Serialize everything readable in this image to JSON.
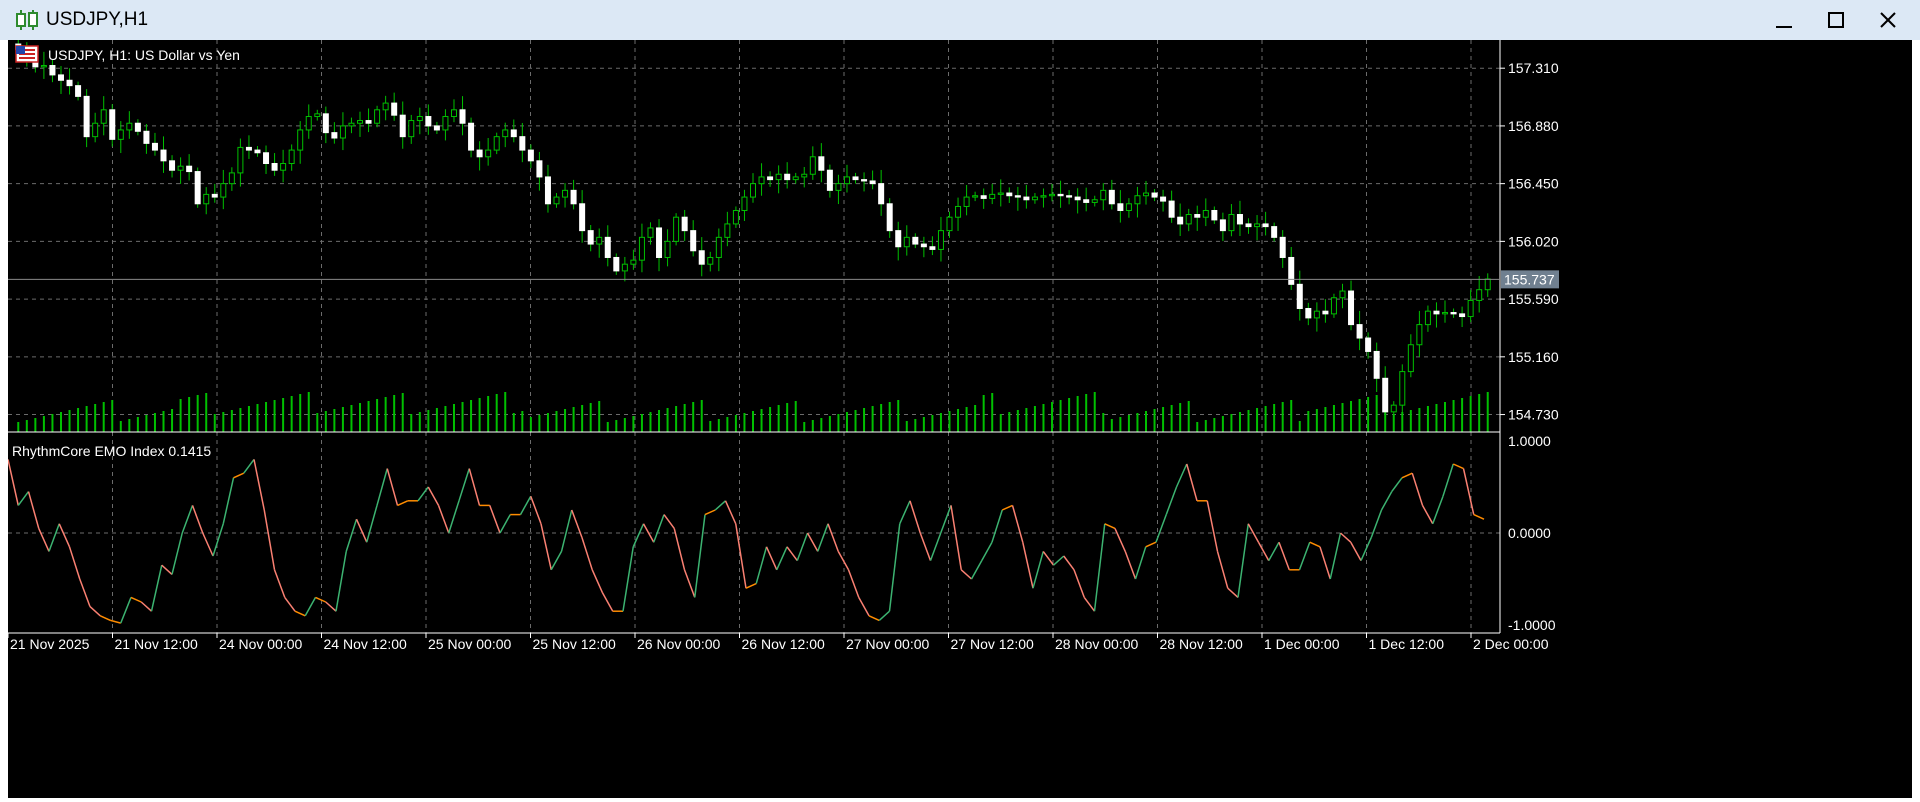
{
  "window": {
    "title": "USDJPY,H1",
    "icon": "candlestick-icon",
    "controls": [
      "minimize-icon",
      "maximize-icon",
      "close-icon"
    ]
  },
  "chart": {
    "symbol_label": "USDJPY, H1:  US Dollar vs Yen",
    "flag_icon": "symbol-flag-icon",
    "current_price": "155.737",
    "price_axis": [
      "157.310",
      "156.880",
      "156.450",
      "156.020",
      "155.590",
      "155.160",
      "154.730"
    ],
    "time_axis": [
      "21 Nov 2025",
      "21 Nov 12:00",
      "24 Nov 00:00",
      "24 Nov 12:00",
      "25 Nov 00:00",
      "25 Nov 12:00",
      "26 Nov 00:00",
      "26 Nov 12:00",
      "27 Nov 00:00",
      "27 Nov 12:00",
      "28 Nov 00:00",
      "28 Nov 12:00",
      "1 Dec 00:00",
      "1 Dec 12:00",
      "2 Dec 00:00"
    ],
    "indicator_label": "RhythmCore EMO Index 0.1415",
    "indicator_axis": [
      "1.0000",
      "0.0000",
      "-1.0000"
    ],
    "colors": {
      "background": "#000000",
      "grid": "#6b6b6b",
      "bull_candle": "#00c000",
      "bear_candle": "#ffffff",
      "volume": "#00c000",
      "indicator_up": "#3cb371",
      "indicator_down": "#fa8072",
      "indicator_neutral": "#ff8c00",
      "axis_text": "#ffffff",
      "price_tag_bg": "#708090"
    }
  },
  "chart_data": [
    {
      "type": "candlestick",
      "title": "USDJPY, H1:  US Dollar vs Yen",
      "timeframe": "H1",
      "y_ticks": [
        157.31,
        156.88,
        156.45,
        156.02,
        155.59,
        155.16,
        154.73
      ],
      "ylim": [
        154.6,
        157.52
      ],
      "x_ticks": [
        "21 Nov 2025",
        "21 Nov 12:00",
        "24 Nov 00:00",
        "24 Nov 12:00",
        "25 Nov 00:00",
        "25 Nov 12:00",
        "26 Nov 00:00",
        "26 Nov 12:00",
        "27 Nov 00:00",
        "27 Nov 12:00",
        "28 Nov 00:00",
        "28 Nov 12:00",
        "1 Dec 00:00",
        "1 Dec 12:00",
        "2 Dec 00:00"
      ],
      "last_price": 155.737,
      "close": [
        157.45,
        157.4,
        157.32,
        157.33,
        157.26,
        157.22,
        157.18,
        157.1,
        156.8,
        156.9,
        157.0,
        156.78,
        156.85,
        156.9,
        156.84,
        156.75,
        156.7,
        156.62,
        156.55,
        156.58,
        156.54,
        156.3,
        156.37,
        156.35,
        156.45,
        156.53,
        156.72,
        156.7,
        156.68,
        156.6,
        156.55,
        156.6,
        156.7,
        156.85,
        156.95,
        156.97,
        156.83,
        156.79,
        156.88,
        156.9,
        156.92,
        156.9,
        157.0,
        157.05,
        156.96,
        156.8,
        156.92,
        156.95,
        156.88,
        156.85,
        156.95,
        157.0,
        156.9,
        156.7,
        156.65,
        156.7,
        156.8,
        156.85,
        156.8,
        156.7,
        156.62,
        156.5,
        156.3,
        156.35,
        156.4,
        156.3,
        156.1,
        156.0,
        156.05,
        155.9,
        155.8,
        155.85,
        155.88,
        156.05,
        156.12,
        155.9,
        156.02,
        156.2,
        156.1,
        155.95,
        155.85,
        155.9,
        156.05,
        156.15,
        156.25,
        156.35,
        156.45,
        156.5,
        156.48,
        156.52,
        156.48,
        156.5,
        156.52,
        156.65,
        156.55,
        156.4,
        156.45,
        156.5,
        156.48,
        156.47,
        156.45,
        156.3,
        156.1,
        155.98,
        156.05,
        156.0,
        155.98,
        155.96,
        156.1,
        156.2,
        156.28,
        156.35,
        156.36,
        156.34,
        156.37,
        156.38,
        156.36,
        156.35,
        156.33,
        156.35,
        156.36,
        156.37,
        156.36,
        156.35,
        156.33,
        156.31,
        156.33,
        156.4,
        156.3,
        156.25,
        156.3,
        156.36,
        156.38,
        156.35,
        156.32,
        156.2,
        156.15,
        156.22,
        156.2,
        156.25,
        156.18,
        156.1,
        156.22,
        156.15,
        156.13,
        156.15,
        156.13,
        156.05,
        155.9,
        155.7,
        155.52,
        155.45,
        155.5,
        155.48,
        155.6,
        155.65,
        155.4,
        155.3,
        155.2,
        155.0,
        154.75,
        154.8,
        155.05,
        155.25,
        155.4,
        155.5,
        155.48,
        155.49,
        155.48,
        155.46,
        155.58,
        155.66,
        155.74
      ],
      "volume_unit": "relative",
      "volume_pattern": "tick volume histogram, higher during 21 Nov 12:00-25 Nov 12:00, 28 Nov 00:00-12:00 and 1 Dec"
    },
    {
      "type": "line",
      "title": "RhythmCore EMO Index 0.1415",
      "ylim": [
        -1.0,
        1.0
      ],
      "y_ticks": [
        1.0,
        0.0,
        -1.0
      ],
      "values": [
        0.8,
        0.3,
        0.45,
        0.05,
        -0.2,
        0.1,
        -0.15,
        -0.5,
        -0.8,
        -0.9,
        -0.95,
        -0.98,
        -0.7,
        -0.75,
        -0.85,
        -0.35,
        -0.45,
        0.0,
        0.3,
        0.0,
        -0.25,
        0.1,
        0.6,
        0.65,
        0.8,
        0.25,
        -0.4,
        -0.7,
        -0.85,
        -0.9,
        -0.7,
        -0.75,
        -0.85,
        -0.2,
        0.15,
        -0.1,
        0.3,
        0.7,
        0.3,
        0.35,
        0.35,
        0.5,
        0.3,
        0.0,
        0.35,
        0.7,
        0.3,
        0.3,
        0.0,
        0.2,
        0.2,
        0.4,
        0.1,
        -0.4,
        -0.2,
        0.25,
        -0.05,
        -0.4,
        -0.65,
        -0.85,
        -0.85,
        -0.15,
        0.1,
        -0.1,
        0.2,
        0.05,
        -0.4,
        -0.7,
        0.2,
        0.25,
        0.35,
        0.1,
        -0.6,
        -0.55,
        -0.15,
        -0.4,
        -0.15,
        -0.3,
        0.0,
        -0.2,
        0.1,
        -0.2,
        -0.4,
        -0.7,
        -0.9,
        -0.95,
        -0.85,
        0.1,
        0.35,
        0.0,
        -0.3,
        0.0,
        0.3,
        -0.4,
        -0.5,
        -0.3,
        -0.1,
        0.25,
        0.3,
        -0.1,
        -0.6,
        -0.2,
        -0.35,
        -0.25,
        -0.4,
        -0.7,
        -0.85,
        0.1,
        0.05,
        -0.2,
        -0.5,
        -0.15,
        -0.1,
        0.2,
        0.5,
        0.75,
        0.35,
        0.35,
        -0.2,
        -0.6,
        -0.7,
        0.1,
        -0.1,
        -0.3,
        -0.1,
        -0.4,
        -0.4,
        -0.1,
        -0.15,
        -0.5,
        0.0,
        -0.1,
        -0.3,
        -0.05,
        0.25,
        0.45,
        0.6,
        0.65,
        0.3,
        0.1,
        0.4,
        0.75,
        0.7,
        0.2,
        0.15
      ]
    }
  ]
}
